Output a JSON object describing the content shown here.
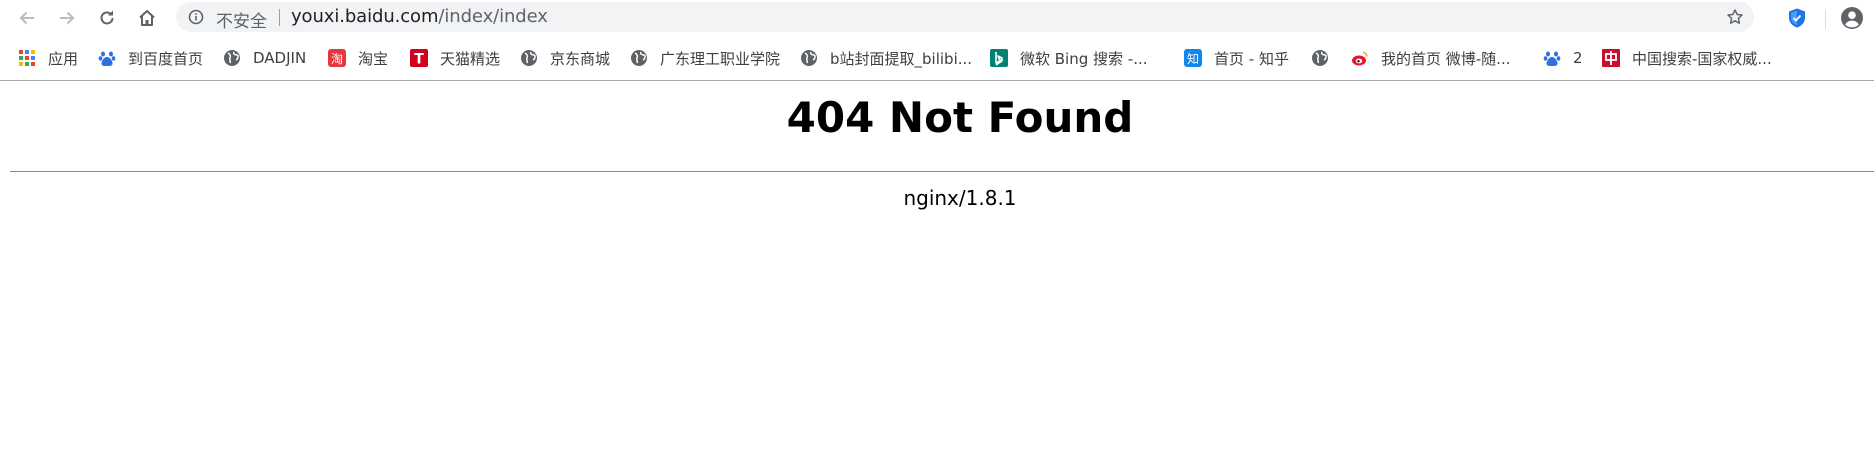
{
  "browser": {
    "security_label": "不安全",
    "url_host": "youxi.baidu.com",
    "url_path": "/index/index",
    "accent_color": "#1a73e8"
  },
  "bookmarks": [
    {
      "label": "应用",
      "icon": "apps-grid-icon"
    },
    {
      "label": "到百度首页",
      "icon": "baidu-paw-icon"
    },
    {
      "label": "DADJIN",
      "icon": "globe-icon"
    },
    {
      "label": "淘宝",
      "icon": "taobao-icon"
    },
    {
      "label": "天猫精选",
      "icon": "tmall-icon"
    },
    {
      "label": "京东商城",
      "icon": "globe-icon"
    },
    {
      "label": "广东理工职业学院",
      "icon": "globe-icon"
    },
    {
      "label": "b站封面提取_bilibi...",
      "icon": "globe-icon"
    },
    {
      "label": "微软 Bing 搜索 -...",
      "icon": "bing-icon"
    },
    {
      "label": "首页 - 知乎",
      "icon": "zhihu-icon"
    },
    {
      "label": "",
      "icon": "globe-icon"
    },
    {
      "label": "我的首页 微博-随...",
      "icon": "weibo-icon"
    },
    {
      "label": "2",
      "icon": "baidu-paw-icon"
    },
    {
      "label": "中国搜索-国家权威...",
      "icon": "chinaso-icon"
    }
  ],
  "page": {
    "title": "404 Not Found",
    "server": "nginx/1.8.1"
  }
}
